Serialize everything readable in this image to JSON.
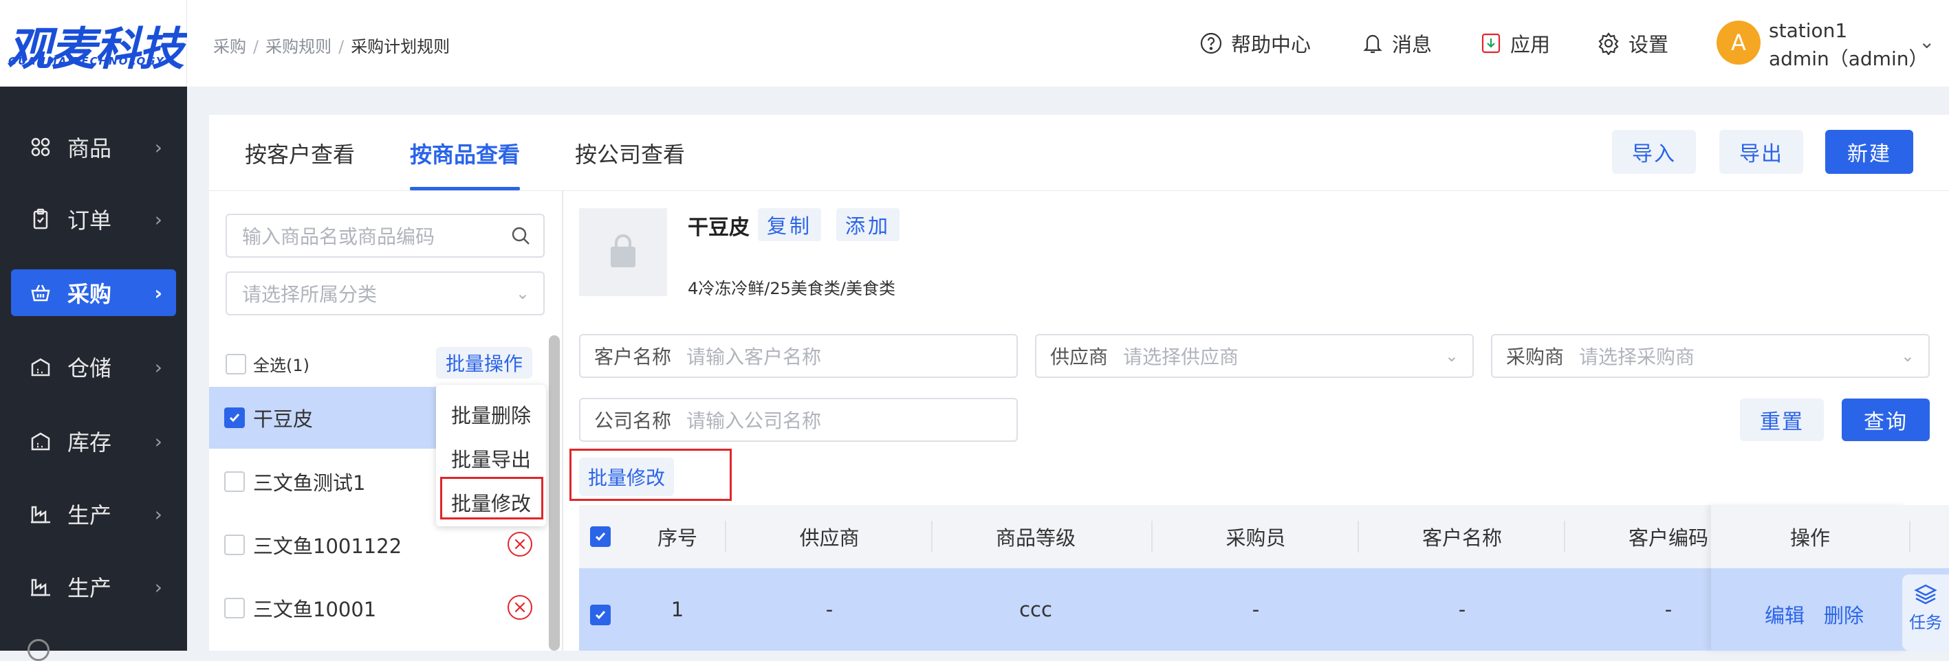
{
  "logo": {
    "main": "观麦科技",
    "sub": "GUANMAITECHNOLOGY"
  },
  "sidebar": {
    "items": [
      {
        "label": "商品",
        "icon": "grid-icon"
      },
      {
        "label": "订单",
        "icon": "order-icon"
      },
      {
        "label": "采购",
        "icon": "basket-icon",
        "active": true
      },
      {
        "label": "仓储",
        "icon": "warehouse-icon"
      },
      {
        "label": "库存",
        "icon": "warehouse-icon"
      },
      {
        "label": "生产",
        "icon": "factory-icon"
      },
      {
        "label": "生产",
        "icon": "factory-icon"
      }
    ]
  },
  "breadcrumb": [
    "采购",
    "采购规则",
    "采购计划规则"
  ],
  "header": {
    "help": "帮助中心",
    "messages": "消息",
    "apps": "应用",
    "settings": "设置",
    "avatar_letter": "A",
    "user_station": "station1",
    "user_name": "admin（admin）"
  },
  "tabs": [
    "按客户查看",
    "按商品查看",
    "按公司查看"
  ],
  "actions": {
    "import": "导入",
    "export": "导出",
    "new": "新建"
  },
  "left_panel": {
    "search_placeholder": "输入商品名或商品编码",
    "category_placeholder": "请选择所属分类",
    "select_all": "全选(1)",
    "batch_ops": "批量操作",
    "batch_menu": [
      "批量删除",
      "批量导出",
      "批量修改"
    ],
    "products": [
      {
        "name": "干豆皮",
        "checked": true
      },
      {
        "name": "三文鱼测试1",
        "checked": false
      },
      {
        "name": "三文鱼1001122",
        "checked": false
      },
      {
        "name": "三文鱼10001",
        "checked": false
      }
    ]
  },
  "product": {
    "name": "干豆皮",
    "copy": "复制",
    "add": "添加",
    "category": "4冷冻冷鲜/25美食类/美食类"
  },
  "filters": {
    "customer_label": "客户名称",
    "customer_placeholder": "请输入客户名称",
    "supplier_label": "供应商",
    "supplier_placeholder": "请选择供应商",
    "buyer_label": "采购商",
    "buyer_placeholder": "请选择采购商",
    "company_label": "公司名称",
    "company_placeholder": "请输入公司名称",
    "reset": "重置",
    "query": "查询",
    "batch_edit": "批量修改"
  },
  "table": {
    "columns": [
      "序号",
      "供应商",
      "商品等级",
      "采购员",
      "客户名称",
      "客户编码",
      "操作"
    ],
    "rows": [
      {
        "index": "1",
        "supplier": "-",
        "grade": "ccc",
        "buyer": "-",
        "customer": "-",
        "customer_code": "-",
        "edit": "编辑",
        "delete": "删除"
      }
    ]
  },
  "task_float": "任务",
  "colors": {
    "primary": "#2a64e8",
    "sidebar_bg": "#232830",
    "highlight": "#e0262a",
    "row_selected": "#c6d8fb"
  }
}
